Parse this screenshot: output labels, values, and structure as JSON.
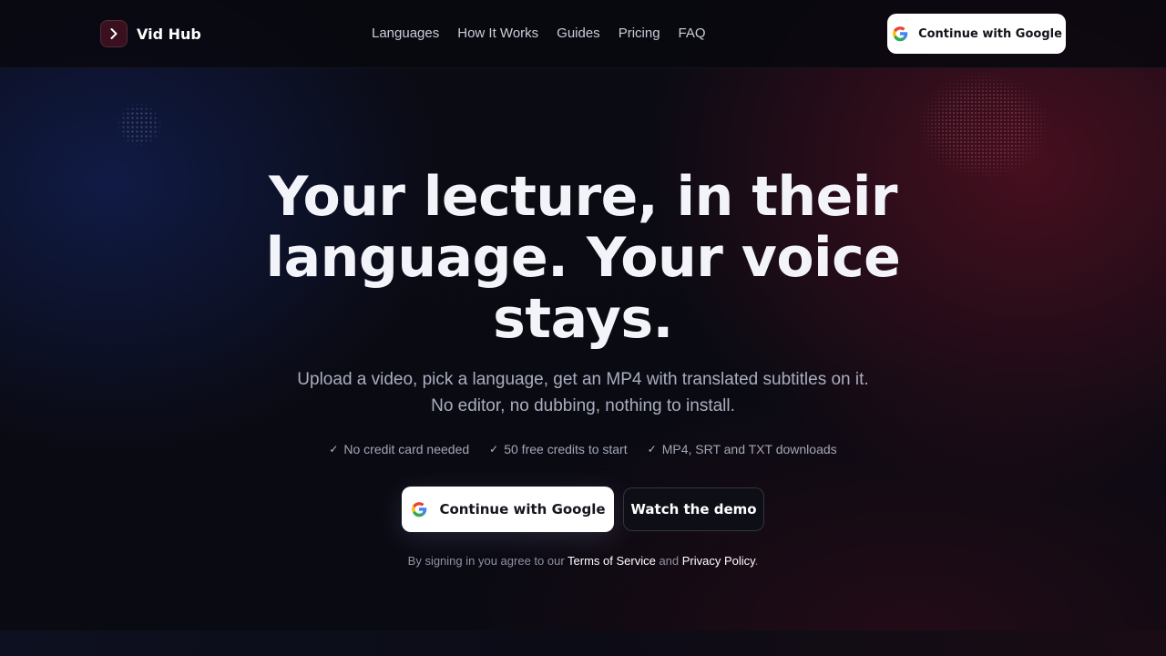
{
  "brand": {
    "name": "Vid Hub",
    "logo_icon": "chevron-right-icon"
  },
  "nav": {
    "items": [
      "Languages",
      "How It Works",
      "Guides",
      "Pricing",
      "FAQ"
    ]
  },
  "header": {
    "cta_label": "Continue with Google",
    "cta_icon": "google-icon"
  },
  "hero": {
    "title": "Your lecture, in their language. Your voice stays.",
    "subtitle_line1": "Upload a video, pick a language, get an MP4 with translated subtitles on it.",
    "subtitle_line2": "No editor, no dubbing, nothing to install.",
    "features": [
      "No credit card needed",
      "50 free credits to start",
      "MP4, SRT and TXT downloads"
    ],
    "primary_cta": "Continue with Google",
    "secondary_cta": "Watch the demo",
    "legal": {
      "prefix": "By signing in you agree to our ",
      "terms": "Terms of Service",
      "and": " and ",
      "privacy": "Privacy Policy",
      "suffix": "."
    }
  },
  "colors": {
    "background": "#0a0a12",
    "brand_accent": "#3a0f1e",
    "button_primary": "#ffffff",
    "text_primary": "#f3f4fa",
    "text_muted": "#a9adbe"
  }
}
